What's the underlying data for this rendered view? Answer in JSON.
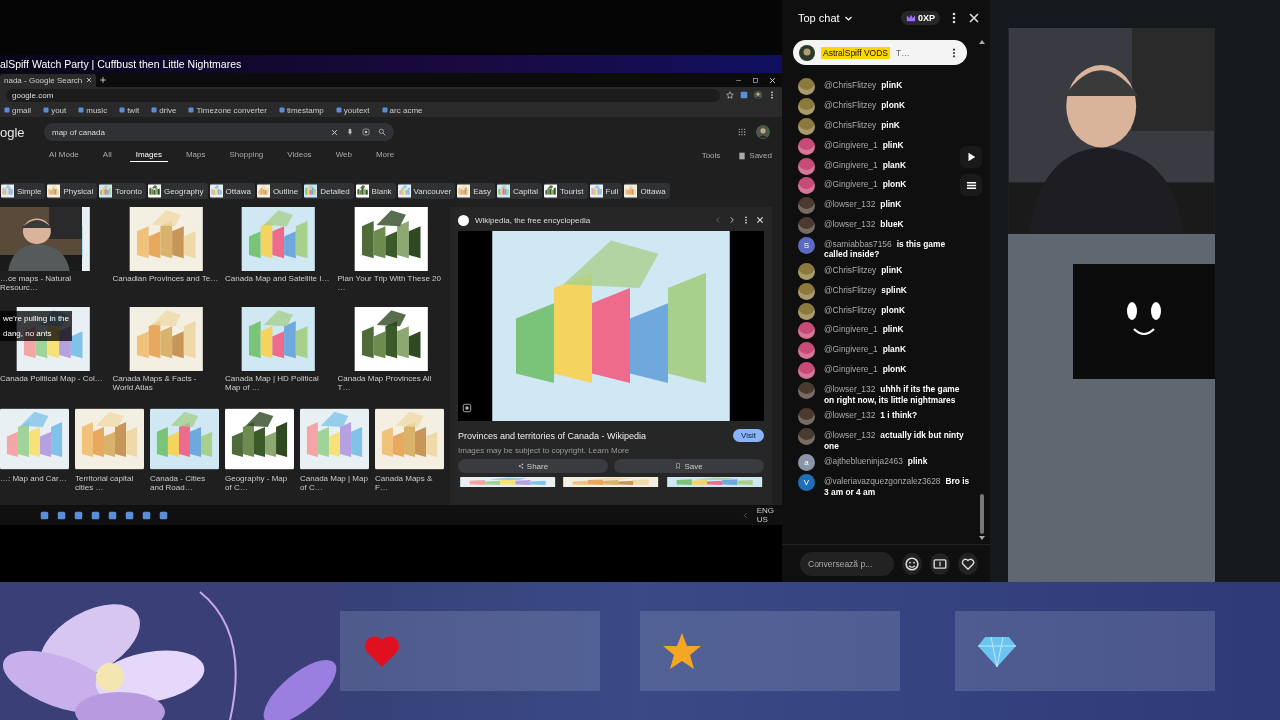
{
  "stream": {
    "title": "alSpiff Watch Party | Cuffbust then Little Nightmares"
  },
  "browser": {
    "tab": "nada - Google Search",
    "url": "google.com",
    "bookmarks": [
      "gmail",
      "yout",
      "music",
      "twit",
      "drive",
      "Timezone converter",
      "timestamp",
      "youtext",
      "arc acme"
    ],
    "logo": "ogle",
    "query": "map of canada",
    "nav": [
      {
        "label": "AI Mode",
        "selected": false
      },
      {
        "label": "All",
        "selected": false
      },
      {
        "label": "Images",
        "selected": true
      },
      {
        "label": "Maps",
        "selected": false
      },
      {
        "label": "Shopping",
        "selected": false
      },
      {
        "label": "Videos",
        "selected": false
      },
      {
        "label": "Web",
        "selected": false
      },
      {
        "label": "More",
        "selected": false
      }
    ],
    "tools": "Tools",
    "saved": "Saved",
    "chips": [
      "Simple",
      "Physical",
      "Toronto",
      "Geography",
      "Ottawa",
      "Outline",
      "Detailed",
      "Blank",
      "Vancouver",
      "Easy",
      "Capital",
      "Tourist",
      "Full",
      "Ottawa"
    ],
    "results": [
      [
        {
          "caption": "…ce maps - Natural Resourc…"
        },
        {
          "caption": "Canadian Provinces and Te…"
        },
        {
          "caption": "Canada Map and Satellite I…"
        },
        {
          "caption": "Plan Your Trip With These 20 …"
        }
      ],
      [
        {
          "caption": "Canada Political Map - Col…"
        },
        {
          "caption": "Canada Maps & Facts - World Atlas"
        },
        {
          "caption": "Canada Map | HD Political Map of …"
        },
        {
          "caption": "Canada Map Provinces All T…"
        }
      ],
      [
        {
          "caption": "…: Map and Car…"
        },
        {
          "caption": "Territorial capital cities …"
        },
        {
          "caption": "Canada - Cities and Road…"
        },
        {
          "caption": "Geography - Map of C…"
        },
        {
          "caption": "Canada Map | Map of C…"
        },
        {
          "caption": "Canada Maps & F…"
        }
      ]
    ],
    "overlay_captions": [
      "we're pulling in the",
      "dang, no ants"
    ],
    "viewer": {
      "source": "Wikipedia, the free encyclopedia",
      "title": "Provinces and territories of Canada - Wikipedia",
      "visit": "Visit",
      "notice": "Images may be subject to copyright. Learn More",
      "share": "Share",
      "save": "Save"
    },
    "taskbar": {
      "lang": "ENG",
      "region": "US"
    }
  },
  "chat": {
    "title": "Top chat",
    "xp": "0XP",
    "pinned": {
      "author": "AstralSpiff VODS",
      "text": "T…"
    },
    "messages": [
      {
        "author": "@ChrisFlitzey",
        "text": "plinK"
      },
      {
        "author": "@ChrisFlitzey",
        "text": "plonK"
      },
      {
        "author": "@ChrisFlitzey",
        "text": "pinK"
      },
      {
        "author": "@Gingivere_1",
        "text": "plinK"
      },
      {
        "author": "@Gingivere_1",
        "text": "planK"
      },
      {
        "author": "@Gingivere_1",
        "text": "plonK"
      },
      {
        "author": "@lowser_132",
        "text": "plinK"
      },
      {
        "author": "@lowser_132",
        "text": "blueK"
      },
      {
        "author": "@samiabbas7156",
        "text": "is this game called inside?",
        "avatar": {
          "kind": "letter",
          "letter": "S",
          "color": "#5c6bc0"
        }
      },
      {
        "author": "@ChrisFlitzey",
        "text": "plinK"
      },
      {
        "author": "@ChrisFlitzey",
        "text": "splinK"
      },
      {
        "author": "@ChrisFlitzey",
        "text": "plonK"
      },
      {
        "author": "@Gingivere_1",
        "text": "plinK"
      },
      {
        "author": "@Gingivere_1",
        "text": "planK"
      },
      {
        "author": "@Gingivere_1",
        "text": "plonK"
      },
      {
        "author": "@lowser_132",
        "text": "uhhh if its the game on right now, its little nightmares"
      },
      {
        "author": "@lowser_132",
        "text": "1 i think?"
      },
      {
        "author": "@lowser_132",
        "text": "actually idk but ninty one"
      },
      {
        "author": "@ajtheblueninja2463",
        "text": "plink",
        "avatar": {
          "kind": "letter",
          "letter": "a",
          "color": "#8a96a8"
        }
      },
      {
        "author": "@valeriavazquezgonzalez3628",
        "text": "Bro is 3 am or 4 am",
        "avatar": {
          "kind": "letter",
          "letter": "V",
          "color": "#1e6fb8"
        }
      }
    ],
    "input": {
      "placeholder": "Conversează p..."
    }
  },
  "overlay": {
    "cards": [
      {
        "kind": "heart"
      },
      {
        "kind": "star"
      },
      {
        "kind": "diamond"
      }
    ]
  }
}
